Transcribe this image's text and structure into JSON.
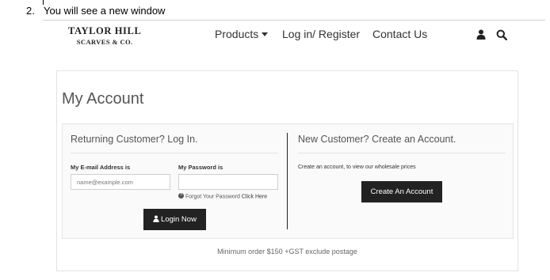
{
  "doc": {
    "step_number": "2.",
    "step_text": "You will see a new window"
  },
  "logo": {
    "line1": "TAYLOR HILL",
    "line2": "SCARVES & CO."
  },
  "nav": {
    "products": "Products",
    "login_register": "Log in/ Register",
    "contact_us": "Contact Us"
  },
  "header_icons": [
    "user-icon",
    "search-icon"
  ],
  "account": {
    "title": "My Account",
    "returning": {
      "heading": "Returning Customer? Log In.",
      "email_label": "My E-mail Address is",
      "email_placeholder": "name@example.com",
      "email_value": "",
      "password_label": "My Password is",
      "forgot_text": "Forgot Your Password",
      "forgot_link": "Click Here",
      "login_button": "Login Now"
    },
    "new_customer": {
      "heading": "New Customer? Create an Account.",
      "note": "Create an account, to view our wholesale prices",
      "create_button": "Create An Account"
    },
    "footer_note": "Minimum order $150 +GST exclude postage"
  },
  "colors": {
    "button_bg": "#222222",
    "text": "#333333"
  }
}
